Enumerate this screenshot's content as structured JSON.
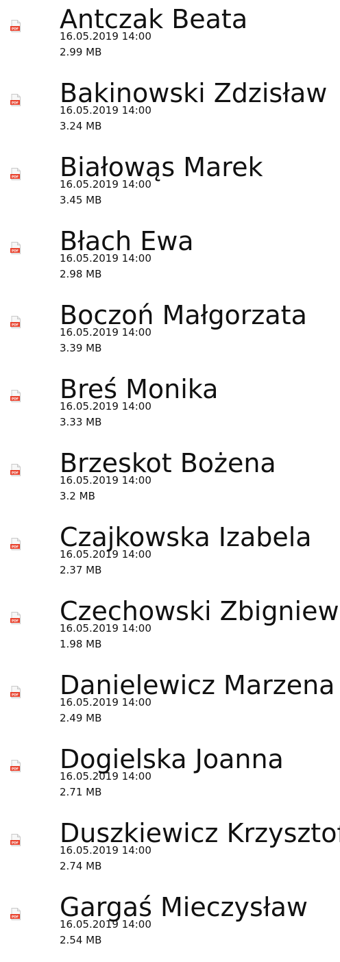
{
  "colors": {
    "text": "#111111",
    "background": "#ffffff",
    "pdf_badge": "#e8412c"
  },
  "icon": "pdf-file-icon",
  "icon_badge_text": "PDF",
  "files": [
    {
      "name": "Antczak Beata",
      "date": "16.05.2019 14:00",
      "size": "2.99 MB"
    },
    {
      "name": "Bakinowski Zdzisław",
      "date": "16.05.2019 14:00",
      "size": "3.24 MB"
    },
    {
      "name": "Białowąs Marek",
      "date": "16.05.2019 14:00",
      "size": "3.45 MB"
    },
    {
      "name": "Błach Ewa",
      "date": "16.05.2019 14:00",
      "size": "2.98 MB"
    },
    {
      "name": "Boczoń Małgorzata",
      "date": "16.05.2019 14:00",
      "size": "3.39 MB"
    },
    {
      "name": "Breś Monika",
      "date": "16.05.2019 14:00",
      "size": "3.33 MB"
    },
    {
      "name": "Brzeskot Bożena",
      "date": "16.05.2019 14:00",
      "size": "3.2 MB"
    },
    {
      "name": "Czajkowska Izabela",
      "date": "16.05.2019 14:00",
      "size": "2.37 MB"
    },
    {
      "name": "Czechowski Zbigniew",
      "date": "16.05.2019 14:00",
      "size": "1.98 MB"
    },
    {
      "name": "Danielewicz Marzena",
      "date": "16.05.2019 14:00",
      "size": "2.49 MB"
    },
    {
      "name": "Dogielska Joanna",
      "date": "16.05.2019 14:00",
      "size": "2.71 MB"
    },
    {
      "name": "Duszkiewicz Krzysztof",
      "date": "16.05.2019 14:00",
      "size": "2.74 MB"
    },
    {
      "name": "Gargaś Mieczysław",
      "date": "16.05.2019 14:00",
      "size": "2.54 MB"
    }
  ]
}
